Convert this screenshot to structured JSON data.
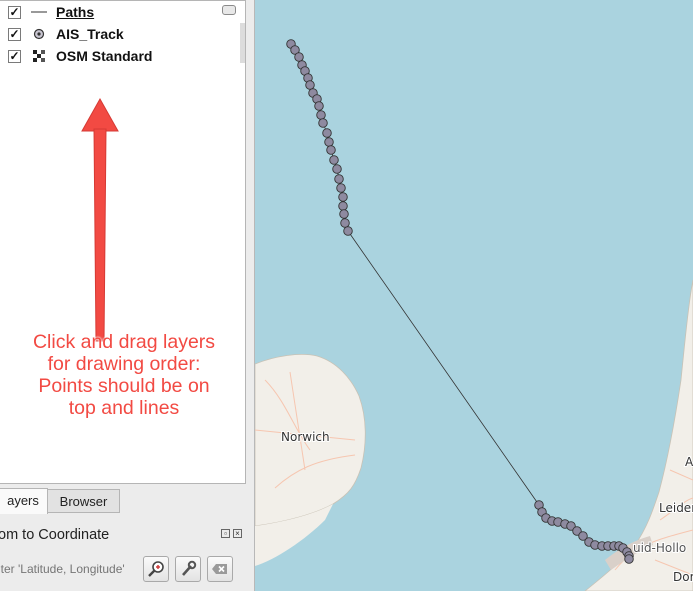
{
  "layers": [
    {
      "name": "Paths",
      "checked": "✓",
      "icon": "line-icon"
    },
    {
      "name": "AIS_Track",
      "checked": "✓",
      "icon": "point-icon"
    },
    {
      "name": "OSM Standard",
      "checked": "✓",
      "icon": "raster-icon"
    }
  ],
  "annotation": {
    "text": "Click and drag layers\nfor drawing order:\nPoints should be on\ntop and lines",
    "color": "#f24a43"
  },
  "tabs": [
    {
      "label": "ayers"
    },
    {
      "label": "Browser"
    }
  ],
  "zoom_panel": {
    "title": "om to Coordinate",
    "placeholder": "nter 'Latitude, Longitude'"
  },
  "map": {
    "labels": {
      "norwich": "Norwich",
      "a": "A",
      "leiden": "Leider",
      "zuid_holland": "uid-Hollo",
      "dor": "Dor"
    },
    "sea_color": "#aad3df",
    "land_color": "#f2efe9",
    "point_fill": "#8e8aa0"
  }
}
